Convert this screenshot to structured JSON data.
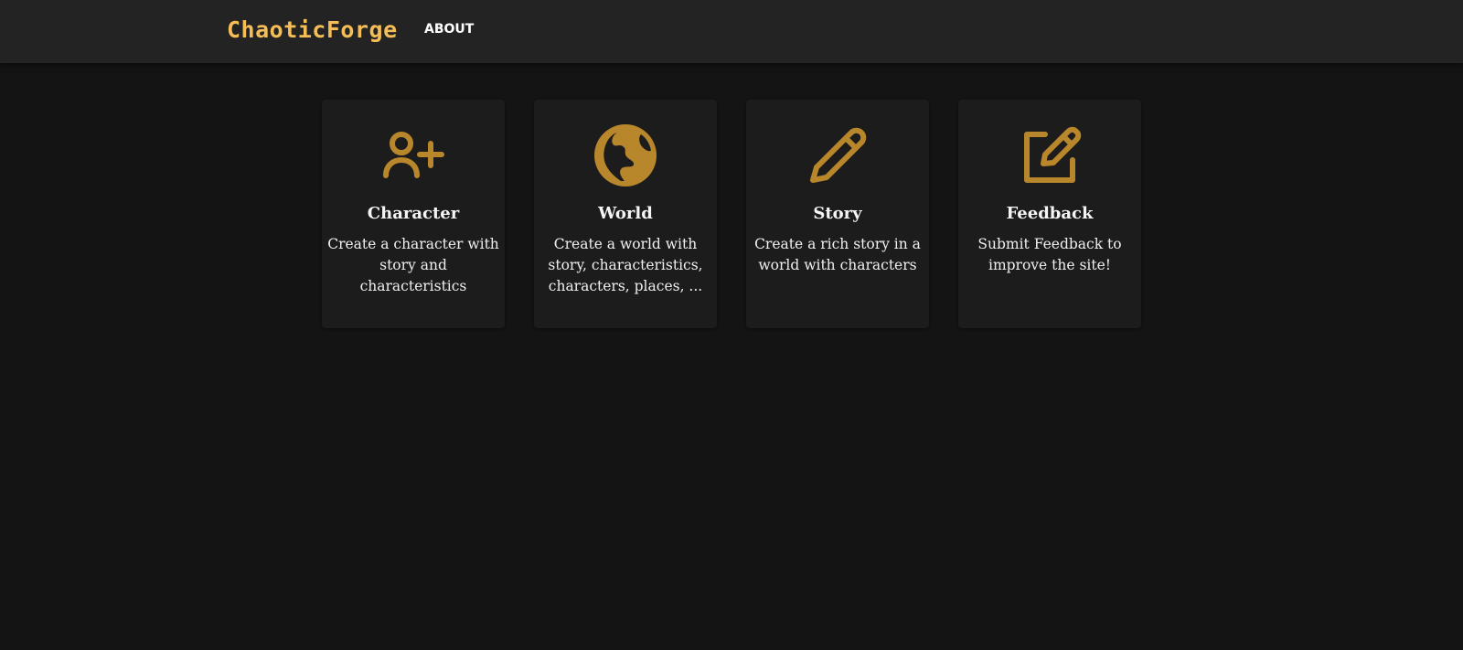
{
  "header": {
    "brand": "ChaoticForge",
    "nav": [
      {
        "label": "ABOUT"
      }
    ]
  },
  "theme": {
    "accent": "#f4bd55",
    "icon_color": "#b8862b",
    "background": "#141414",
    "header_bg": "#232323",
    "card_bg": "#1c1c1c"
  },
  "cards": [
    {
      "icon": "user-plus-icon",
      "title": "Character",
      "description": "Create a character with story and characteristics"
    },
    {
      "icon": "globe-icon",
      "title": "World",
      "description": "Create a world with story, characteristics, characters, places, ..."
    },
    {
      "icon": "pencil-icon",
      "title": "Story",
      "description": "Create a rich story in a world with characters"
    },
    {
      "icon": "edit-square-icon",
      "title": "Feedback",
      "description": "Submit Feedback to improve the site!"
    }
  ]
}
